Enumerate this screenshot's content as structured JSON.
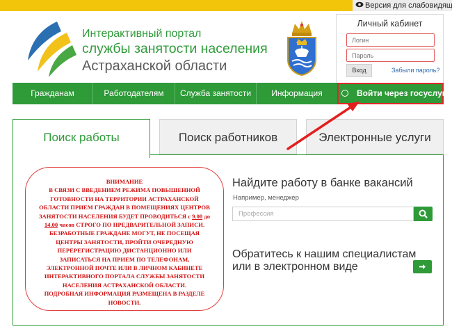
{
  "topbar": {
    "vision_label": "Версия для слабовидящих"
  },
  "portal": {
    "line1": "Интерактивный портал",
    "line2": "службы занятости населения",
    "line3": "Астраханской области"
  },
  "cabinet": {
    "title": "Личный кабинет",
    "login_placeholder": "Логин",
    "password_placeholder": "Пароль",
    "login_button": "Вход",
    "forgot_link": "Забыли пароль?"
  },
  "nav": {
    "items": [
      "Гражданам",
      "Работодателям",
      "Служба занятости",
      "Информация"
    ],
    "gosuslugi": "Войти через госуслуги"
  },
  "tabs": [
    "Поиск работы",
    "Поиск работников",
    "Электронные услуги"
  ],
  "notice": {
    "lines": [
      "ВНИМАНИЕ",
      "В СВЯЗИ С ВВЕДЕНИЕМ РЕЖИМА ПОВЫШЕННОЙ",
      "ГОТОВНОСТИ НА ТЕРРИТОРИИ АСТРАХАНСКОЙ",
      "ОБЛАСТИ ПРИЕМ ГРАЖДАН В ПОМЕЩЕНИЯХ ЦЕНТРОВ",
      "ЗАНЯТОСТИ НАСЕЛЕНИЯ БУДЕТ ПРОВОДИТЬСЯ",
      "часов СТРОГО ПО ПРЕДВАРИТЕЛЬНОЙ ЗАПИСИ.",
      "БЕЗРАБОТНЫЕ ГРАЖДАНЕ МОГУТ, НЕ ПОСЕЩАЯ",
      "ЦЕНТРЫ ЗАНЯТОСТИ, ПРОЙТИ ОЧЕРЕДНУЮ",
      "ПЕРЕРЕГИСТРАЦИЮ ДИСТАНЦИОННО ИЛИ",
      "ЗАПИСАТЬСЯ НА ПРИЕМ ПО ТЕЛЕФОНАМ,",
      "ЭЛЕКТРОННОЙ ПОЧТЕ ИЛИ В ЛИЧНОМ КАБИНЕТЕ",
      "ИНТЕРАКТИВНОГО ПОРТАЛА СЛУЖБЫ ЗАНЯТОСТИ",
      "НАСЕЛЕНИЯ АСТРАХАНСКОЙ ОБЛАСТИ.",
      "ПОДРОБНАЯ ИНФОРМАЦИЯ РАЗМЕЩЕНА В РАЗДЕЛЕ",
      "НОВОСТИ."
    ],
    "inline_s": "с",
    "time_from": "9.00",
    "inline_do": "до",
    "time_to": "14.00"
  },
  "bank": {
    "title": "Найдите работу в банке вакансий",
    "subtitle": "Например, менеджер",
    "placeholder": "Профессия",
    "search_icon": "search-icon"
  },
  "contact": {
    "title": "Обратитесь к нашим специалистам или в электронном виде",
    "arrow_icon": "arrow-right-icon"
  },
  "colors": {
    "brand_green": "#2e9a38",
    "accent_yellow": "#f3c50a",
    "alert_red": "#d01414"
  }
}
